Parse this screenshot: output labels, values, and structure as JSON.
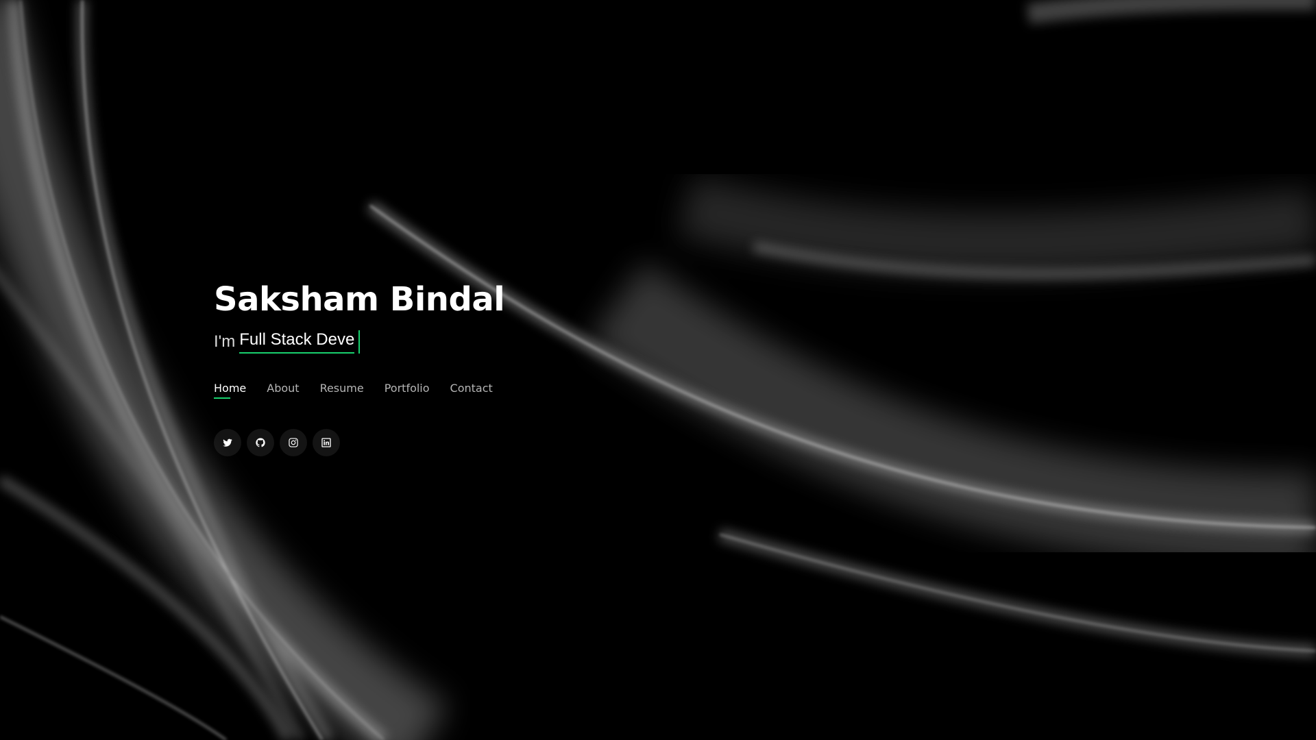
{
  "hero": {
    "name": "Saksham Bindal",
    "prefix": "I'm",
    "typed_text": "Full Stack Deve"
  },
  "nav": {
    "items": [
      {
        "label": "Home",
        "active": true
      },
      {
        "label": "About",
        "active": false
      },
      {
        "label": "Resume",
        "active": false
      },
      {
        "label": "Portfolio",
        "active": false
      },
      {
        "label": "Contact",
        "active": false
      }
    ]
  },
  "social": {
    "icons": [
      "twitter-icon",
      "github-icon",
      "instagram-icon",
      "linkedin-icon"
    ]
  },
  "colors": {
    "accent": "#18d26e",
    "background": "#000000",
    "text": "#ffffff"
  }
}
